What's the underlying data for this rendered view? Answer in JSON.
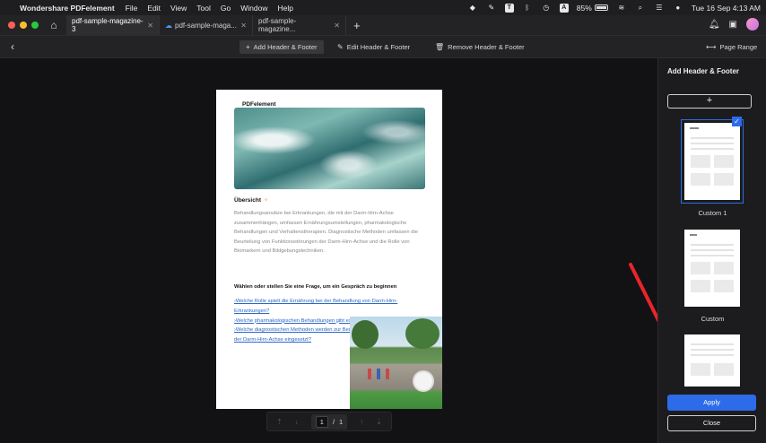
{
  "menubar": {
    "app_name": "Wondershare PDFelement",
    "menus": [
      "File",
      "Edit",
      "View",
      "Tool",
      "Go",
      "Window",
      "Help"
    ],
    "battery": "85%",
    "datetime": "Tue 16 Sep  4:13 AM",
    "input_indicator": "A"
  },
  "tabs": [
    {
      "label": "pdf-sample-magazine-3",
      "active": true,
      "cloud": false
    },
    {
      "label": "pdf-sample-maga...",
      "active": false,
      "cloud": true
    },
    {
      "label": "pdf-sample-magazine...",
      "active": false,
      "cloud": false
    }
  ],
  "toolbar": {
    "add_label": "Add Header & Footer",
    "edit_label": "Edit Header & Footer",
    "remove_label": "Remove Header & Footer",
    "range_label": "Page Range"
  },
  "document": {
    "header_text": "PDFelement",
    "section_title": "Übersicht",
    "body_text": "Behandlungsansätze bei Erkrankungen, die mit der Darm-Hirn-Achse zusammenhängen, umfassen Ernährungsumstellungen, pharmakologische Behandlungen und Verhaltenstherapien. Diagnostische Methoden umfassen die Beurteilung von Funktionsstörungen der Darm-Hirn-Achse und die Rolle von Biomarkern und Bildgebungstechniken.",
    "question_title": "Wählen oder stellen Sie eine Frage, um ein Gespräch zu beginnen",
    "questions": [
      "›Welche Rolle spielt die Ernährung bei der Behandlung von Darm-Hirn-Erkrankungen?",
      "›Welche pharmakologischen Behandlungen gibt es für die Darm-Hirn-Achse?",
      "›Welche diagnostischen Methoden werden zur Beurteilung von Funktionsstörungen der Darm-Hirn-Achse eingesetzt?"
    ]
  },
  "pager": {
    "current": "1",
    "separator": "/",
    "total": "1"
  },
  "panel": {
    "title": "Add Header & Footer",
    "add_symbol": "+",
    "templates": [
      {
        "label": "Custom 1",
        "selected": true
      },
      {
        "label": "Custom",
        "selected": false
      },
      {
        "label": "",
        "selected": false
      }
    ],
    "apply_label": "Apply",
    "close_label": "Close"
  },
  "colors": {
    "accent": "#2d6be8",
    "annotation_arrow": "#e8252b",
    "link": "#2b68c4"
  }
}
